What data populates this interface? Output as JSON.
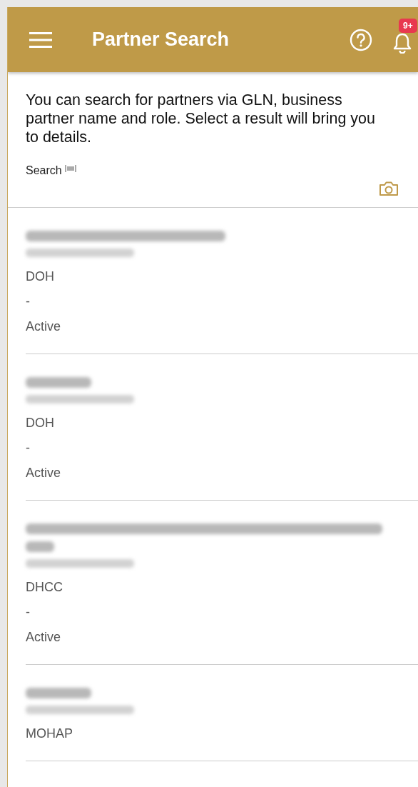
{
  "app_bar": {
    "title": "Partner Search",
    "notification_badge": "9+"
  },
  "intro": "You can search for partners via GLN, business partner name and role. Select a result will bring you to details.",
  "search": {
    "label": "Search"
  },
  "partners": [
    {
      "name_wrapped": false,
      "role": "DOH",
      "separator": "-",
      "status": "Active"
    },
    {
      "name_wrapped": false,
      "role": "DOH",
      "separator": "-",
      "status": "Active"
    },
    {
      "name_wrapped": true,
      "role": "DHCC",
      "separator": "-",
      "status": "Active"
    },
    {
      "name_wrapped": false,
      "role": "MOHAP"
    }
  ]
}
